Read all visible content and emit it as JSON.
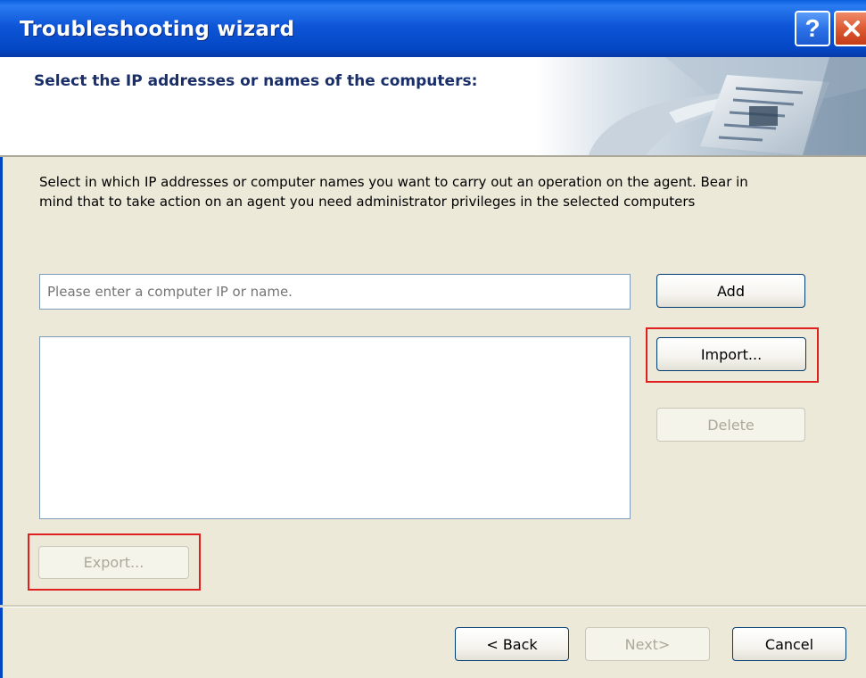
{
  "window": {
    "title": "Troubleshooting wizard",
    "help_label": "?",
    "close_icon": "close-icon",
    "colors": {
      "titlebar": "#0a5fe0",
      "header_title": "#1a2f6a",
      "highlight": "#e02020",
      "dialog_bg": "#ece9d8"
    }
  },
  "header": {
    "title": "Select the IP addresses or names of the computers:",
    "image": "hand-touching-screen-illustration"
  },
  "body": {
    "description": "Select in which IP addresses or computer names you want to carry out an operation on the agent. Bear in mind that to take action on an agent you need administrator privileges in the selected computers",
    "ip_input": {
      "value": "",
      "placeholder": "Please enter a computer IP or name."
    },
    "computer_list": [],
    "buttons": {
      "add": "Add",
      "import": "Import...",
      "delete": "Delete",
      "export": "Export..."
    }
  },
  "footer": {
    "back": "< Back",
    "next": "Next>",
    "cancel": "Cancel"
  }
}
